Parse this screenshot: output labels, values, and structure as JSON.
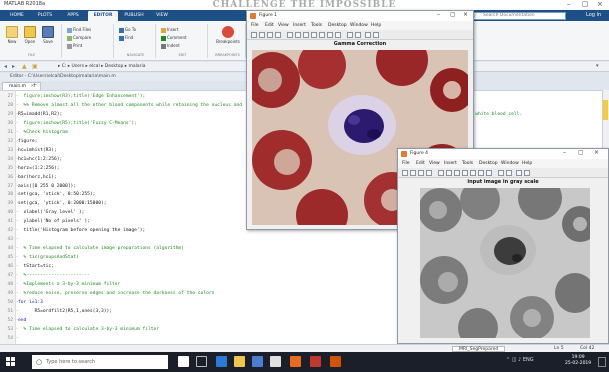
{
  "banner": "CHALLENGE THE IMPOSSIBLE",
  "window": {
    "title": "MATLAB R2018a"
  },
  "ribbon": {
    "tabs": [
      "HOME",
      "PLOTS",
      "APPS",
      "EDITOR",
      "PUBLISH",
      "VIEW"
    ],
    "active_tab": "EDITOR",
    "search_placeholder": "Search Documentation",
    "login": "Log In",
    "buttons": {
      "new": "New",
      "open": "Open",
      "save": "Save",
      "find_files": "Find Files",
      "compare": "Compare",
      "print": "Print",
      "go_to": "Go To",
      "find": "Find",
      "insert": "Insert",
      "comment": "Comment",
      "indent": "Indent",
      "breakpoints": "Breakpoints"
    },
    "groups": {
      "file": "FILE",
      "navigate": "NAVIGATE",
      "edit": "EDIT",
      "breakpoints": "BREAKPOINTS"
    }
  },
  "address_bar": {
    "path": "▸ C: ▸ Users ▸ elcal ▸ Desktop ▸ malaria"
  },
  "editor": {
    "title": "Editor - C:\\Users\\elcal\\Desktop\\malaria\\main.m",
    "tab": "main.m",
    "right_comment": "part of the white blood cell.",
    "lines": [
      {
        "n": "27",
        "text": "  figure;imshow(R3);title('Edge Enhancement');",
        "kind": "comment"
      },
      {
        "n": "28",
        "text": "  %% Remove almost all the other blood components while retaining the nucleus and",
        "kind": "comment"
      },
      {
        "n": "29",
        "text": "R5=imadd(R1,R2);",
        "kind": "code"
      },
      {
        "n": "30",
        "text": "  figure;imshow(R5);title('Fuzzy C-Means');",
        "kind": "comment"
      },
      {
        "n": "31",
        "text": "  %Check histogram",
        "kind": "comment"
      },
      {
        "n": "32",
        "text": "figure;",
        "kind": "code"
      },
      {
        "n": "33",
        "text": "hc=imhist(R3);",
        "kind": "code"
      },
      {
        "n": "34",
        "text": "hc1=hc(1:2:256);",
        "kind": "code"
      },
      {
        "n": "35",
        "text": "horz=(1:2:256);",
        "kind": "code"
      },
      {
        "n": "36",
        "text": "bar(horz,hc1);",
        "kind": "code"
      },
      {
        "n": "37",
        "text": "axis([0 255 0 2000]);",
        "kind": "code"
      },
      {
        "n": "38",
        "text": "set(gca, 'xtick', 0:50:255);",
        "kind": "code"
      },
      {
        "n": "39",
        "text": "set(gca, 'ytick', 0:2000:15000);",
        "kind": "code"
      },
      {
        "n": "40",
        "text": "  xlabel('Gray level' );",
        "kind": "code"
      },
      {
        "n": "41",
        "text": "  ylabel('No of pixels' );",
        "kind": "code"
      },
      {
        "n": "42",
        "text": "  title('Histogram before opening the image');",
        "kind": "code"
      },
      {
        "n": "43",
        "text": "",
        "kind": "code"
      },
      {
        "n": "44",
        "text": "  % Time elapsed to calculate image preparations (algorithm)",
        "kind": "comment"
      },
      {
        "n": "45",
        "text": "  % tic(groupsAndStat)",
        "kind": "comment"
      },
      {
        "n": "46",
        "text": "  tStart=tic;",
        "kind": "code"
      },
      {
        "n": "47",
        "text": "  %-----------------------",
        "kind": "comment"
      },
      {
        "n": "48",
        "text": "  %Implements a 3-by-3 minimum filter",
        "kind": "comment"
      },
      {
        "n": "49",
        "text": "  %reduce noise, preserve edges and increase the darkness of the colors",
        "kind": "comment"
      },
      {
        "n": "50",
        "text": "for i=1:3",
        "kind": "kw"
      },
      {
        "n": "51",
        "text": "      R5=ordfilt2(R5,1,ones(3,3));",
        "kind": "code"
      },
      {
        "n": "52",
        "text": "end",
        "kind": "kw"
      },
      {
        "n": "53",
        "text": "  % Time elapsed to calculate 3-by-3 minimum filter",
        "kind": "comment"
      },
      {
        "n": "54",
        "text": "",
        "kind": "code"
      }
    ]
  },
  "status_bar": {
    "script": "MRI_SegPrepared",
    "ln": "Ln 5",
    "col": "Col 42"
  },
  "figure1": {
    "title": "Figure 1",
    "menu": [
      "File",
      "Edit",
      "View",
      "Insert",
      "Tools",
      "Desktop",
      "Window",
      "Help"
    ],
    "caption": "Gamma Correction"
  },
  "figure4": {
    "title": "Figure 4",
    "menu": [
      "File",
      "Edit",
      "View",
      "Insert",
      "Tools",
      "Desktop",
      "Window",
      "Help"
    ],
    "caption": "input image in gray scale"
  },
  "taskbar": {
    "search_placeholder": "Type here to search",
    "time": "19:09",
    "date": "25-02-2019",
    "lang": "ENG\nIN"
  },
  "colors": {
    "ribbon": "#1e4f86",
    "comment": "#1f8a1f",
    "keyword": "#1010c8"
  }
}
